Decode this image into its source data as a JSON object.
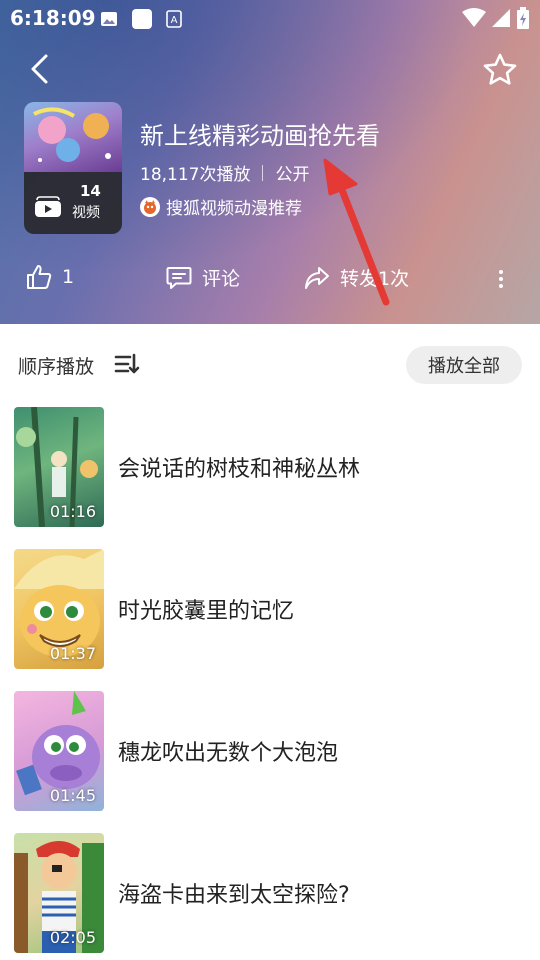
{
  "status_bar": {
    "time": "6:18:09"
  },
  "header": {
    "title": "新上线精彩动画抢先看",
    "play_count": "18,117次播放",
    "visibility": "公开",
    "author": "搜狐视频动漫推荐",
    "cover": {
      "count": "14",
      "unit": "视频"
    },
    "actions": {
      "like_count": "1",
      "comment_label": "评论",
      "share_label": "转发1次"
    }
  },
  "sort": {
    "label": "顺序播放",
    "play_all": "播放全部"
  },
  "videos": [
    {
      "title": "会说话的树枝和神秘丛林",
      "duration": "01:16"
    },
    {
      "title": "时光胶囊里的记忆",
      "duration": "01:37"
    },
    {
      "title": "穗龙吹出无数个大泡泡",
      "duration": "01:45"
    },
    {
      "title": "海盗卡由来到太空探险?",
      "duration": "02:05"
    }
  ],
  "colors": {
    "annotation_arrow": "#e53935",
    "play_all_bg": "#eeeeee"
  }
}
